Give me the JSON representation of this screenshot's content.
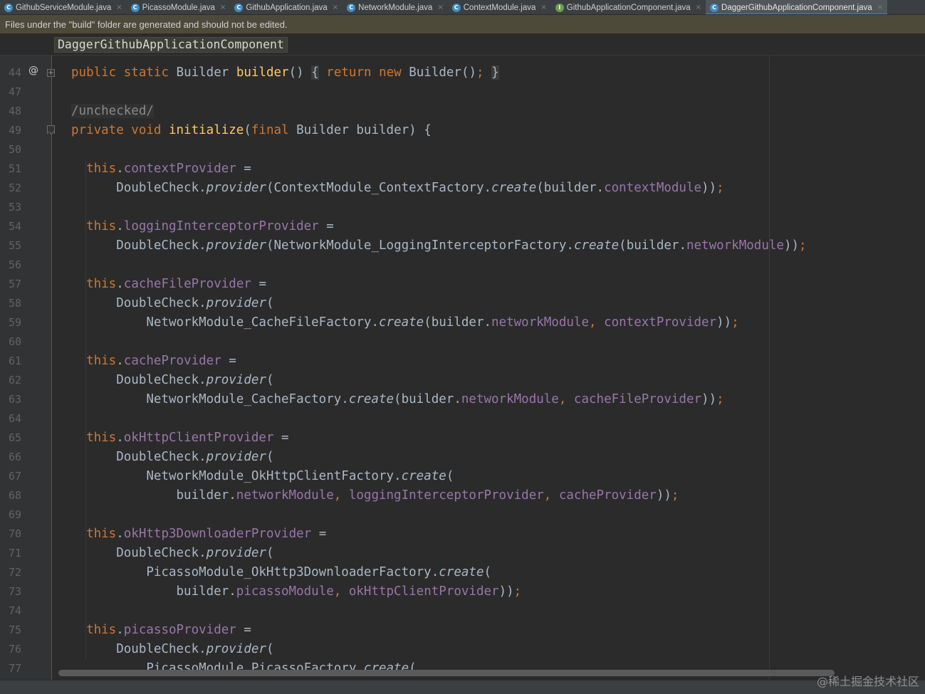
{
  "tabs": [
    {
      "label": "GithubServiceModule.java",
      "type": "c",
      "active": false
    },
    {
      "label": "PicassoModule.java",
      "type": "c",
      "active": false
    },
    {
      "label": "GithubApplication.java",
      "type": "c",
      "active": false
    },
    {
      "label": "NetworkModule.java",
      "type": "c",
      "active": false
    },
    {
      "label": "ContextModule.java",
      "type": "c",
      "active": false
    },
    {
      "label": "GithubApplicationComponent.java",
      "type": "i",
      "active": false
    },
    {
      "label": "DaggerGithubApplicationComponent.java",
      "type": "c",
      "active": true
    }
  ],
  "tab_icon_letters": {
    "c": "C",
    "i": "I"
  },
  "tab_close": "×",
  "banner": {
    "text": "Files under the \"build\" folder are generated and should not be edited."
  },
  "breadcrumb": {
    "label": "DaggerGithubApplicationComponent"
  },
  "gutter": {
    "at_symbol": "@",
    "fold_plus": "+"
  },
  "lines": [
    {
      "n": "44",
      "t": [
        [
          "kw",
          "public "
        ],
        [
          "kw",
          "static "
        ],
        [
          "",
          "Builder "
        ],
        [
          "fn",
          "builder"
        ],
        [
          "",
          "() "
        ],
        [
          "hl",
          "{"
        ],
        [
          "",
          " "
        ],
        [
          "kw",
          "return "
        ],
        [
          "kw",
          "new "
        ],
        [
          "",
          "Builder()"
        ],
        [
          "kw",
          ";"
        ],
        [
          "",
          " "
        ],
        [
          "hl",
          "}"
        ]
      ]
    },
    {
      "n": "47",
      "t": []
    },
    {
      "n": "48",
      "t": [
        [
          "unc",
          "/unchecked/"
        ]
      ]
    },
    {
      "n": "49",
      "t": [
        [
          "kw",
          "private "
        ],
        [
          "kw",
          "void "
        ],
        [
          "fn",
          "initialize"
        ],
        [
          "",
          "("
        ],
        [
          "kw",
          "final "
        ],
        [
          "",
          "Builder builder) {"
        ]
      ]
    },
    {
      "n": "50",
      "t": []
    },
    {
      "n": "51",
      "t": [
        [
          "",
          "  "
        ],
        [
          "kw",
          "this"
        ],
        [
          "",
          "."
        ],
        [
          "fld",
          "contextProvider"
        ],
        [
          "",
          " ="
        ]
      ]
    },
    {
      "n": "52",
      "t": [
        [
          "",
          "      DoubleCheck."
        ],
        [
          "it",
          "provider"
        ],
        [
          "",
          "(ContextModule_ContextFactory."
        ],
        [
          "it",
          "create"
        ],
        [
          "",
          "(builder."
        ],
        [
          "fld",
          "contextModule"
        ],
        [
          "",
          "))"
        ],
        [
          "kw",
          ";"
        ]
      ]
    },
    {
      "n": "53",
      "t": []
    },
    {
      "n": "54",
      "t": [
        [
          "",
          "  "
        ],
        [
          "kw",
          "this"
        ],
        [
          "",
          "."
        ],
        [
          "fld",
          "loggingInterceptorProvider"
        ],
        [
          "",
          " ="
        ]
      ]
    },
    {
      "n": "55",
      "t": [
        [
          "",
          "      DoubleCheck."
        ],
        [
          "it",
          "provider"
        ],
        [
          "",
          "(NetworkModule_LoggingInterceptorFactory."
        ],
        [
          "it",
          "create"
        ],
        [
          "",
          "(builder."
        ],
        [
          "fld",
          "networkModule"
        ],
        [
          "",
          "))"
        ],
        [
          "kw",
          ";"
        ]
      ]
    },
    {
      "n": "56",
      "t": []
    },
    {
      "n": "57",
      "t": [
        [
          "",
          "  "
        ],
        [
          "kw",
          "this"
        ],
        [
          "",
          "."
        ],
        [
          "fld",
          "cacheFileProvider"
        ],
        [
          "",
          " ="
        ]
      ]
    },
    {
      "n": "58",
      "t": [
        [
          "",
          "      DoubleCheck."
        ],
        [
          "it",
          "provider"
        ],
        [
          "",
          "("
        ]
      ]
    },
    {
      "n": "59",
      "t": [
        [
          "",
          "          NetworkModule_CacheFileFactory."
        ],
        [
          "it",
          "create"
        ],
        [
          "",
          "(builder."
        ],
        [
          "fld",
          "networkModule"
        ],
        [
          "kw",
          ", "
        ],
        [
          "fld",
          "contextProvider"
        ],
        [
          "",
          "))"
        ],
        [
          "kw",
          ";"
        ]
      ]
    },
    {
      "n": "60",
      "t": []
    },
    {
      "n": "61",
      "t": [
        [
          "",
          "  "
        ],
        [
          "kw",
          "this"
        ],
        [
          "",
          "."
        ],
        [
          "fld",
          "cacheProvider"
        ],
        [
          "",
          " ="
        ]
      ]
    },
    {
      "n": "62",
      "t": [
        [
          "",
          "      DoubleCheck."
        ],
        [
          "it",
          "provider"
        ],
        [
          "",
          "("
        ]
      ]
    },
    {
      "n": "63",
      "t": [
        [
          "",
          "          NetworkModule_CacheFactory."
        ],
        [
          "it",
          "create"
        ],
        [
          "",
          "(builder."
        ],
        [
          "fld",
          "networkModule"
        ],
        [
          "kw",
          ", "
        ],
        [
          "fld",
          "cacheFileProvider"
        ],
        [
          "",
          "))"
        ],
        [
          "kw",
          ";"
        ]
      ]
    },
    {
      "n": "64",
      "t": []
    },
    {
      "n": "65",
      "t": [
        [
          "",
          "  "
        ],
        [
          "kw",
          "this"
        ],
        [
          "",
          "."
        ],
        [
          "fld",
          "okHttpClientProvider"
        ],
        [
          "",
          " ="
        ]
      ]
    },
    {
      "n": "66",
      "t": [
        [
          "",
          "      DoubleCheck."
        ],
        [
          "it",
          "provider"
        ],
        [
          "",
          "("
        ]
      ]
    },
    {
      "n": "67",
      "t": [
        [
          "",
          "          NetworkModule_OkHttpClientFactory."
        ],
        [
          "it",
          "create"
        ],
        [
          "",
          "("
        ]
      ]
    },
    {
      "n": "68",
      "t": [
        [
          "",
          "              builder."
        ],
        [
          "fld",
          "networkModule"
        ],
        [
          "kw",
          ", "
        ],
        [
          "fld",
          "loggingInterceptorProvider"
        ],
        [
          "kw",
          ", "
        ],
        [
          "fld",
          "cacheProvider"
        ],
        [
          "",
          "))"
        ],
        [
          "kw",
          ";"
        ]
      ]
    },
    {
      "n": "69",
      "t": []
    },
    {
      "n": "70",
      "t": [
        [
          "",
          "  "
        ],
        [
          "kw",
          "this"
        ],
        [
          "",
          "."
        ],
        [
          "fld",
          "okHttp3DownloaderProvider"
        ],
        [
          "",
          " ="
        ]
      ]
    },
    {
      "n": "71",
      "t": [
        [
          "",
          "      DoubleCheck."
        ],
        [
          "it",
          "provider"
        ],
        [
          "",
          "("
        ]
      ]
    },
    {
      "n": "72",
      "t": [
        [
          "",
          "          PicassoModule_OkHttp3DownloaderFactory."
        ],
        [
          "it",
          "create"
        ],
        [
          "",
          "("
        ]
      ]
    },
    {
      "n": "73",
      "t": [
        [
          "",
          "              builder."
        ],
        [
          "fld",
          "picassoModule"
        ],
        [
          "kw",
          ", "
        ],
        [
          "fld",
          "okHttpClientProvider"
        ],
        [
          "",
          "))"
        ],
        [
          "kw",
          ";"
        ]
      ]
    },
    {
      "n": "74",
      "t": []
    },
    {
      "n": "75",
      "t": [
        [
          "",
          "  "
        ],
        [
          "kw",
          "this"
        ],
        [
          "",
          "."
        ],
        [
          "fld",
          "picassoProvider"
        ],
        [
          "",
          " ="
        ]
      ]
    },
    {
      "n": "76",
      "t": [
        [
          "",
          "      DoubleCheck."
        ],
        [
          "it",
          "provider"
        ],
        [
          "",
          "("
        ]
      ]
    },
    {
      "n": "77",
      "t": [
        [
          "",
          "          PicassoModule_PicassoFactory."
        ],
        [
          "it",
          "create"
        ],
        [
          "",
          "("
        ]
      ]
    }
  ],
  "watermark": "@稀土掘金技术社区",
  "colors": {
    "background": "#2b2b2b",
    "keyword": "#cc7832",
    "method": "#ffc66d",
    "field": "#9876aa",
    "text": "#a9b7c6",
    "line_number": "#606366",
    "active_tab_underline": "#4a88c7"
  }
}
